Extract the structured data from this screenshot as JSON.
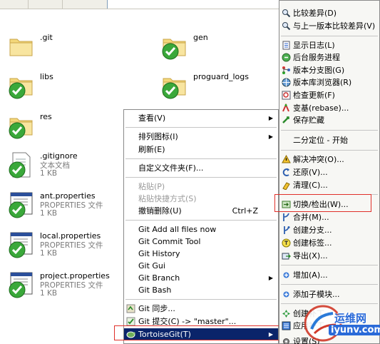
{
  "files": [
    {
      "name": ".git",
      "type": "",
      "size": "",
      "icon": "folder-icon",
      "status": "none"
    },
    {
      "name": "gen",
      "type": "",
      "size": "",
      "icon": "folder-icon",
      "status": "normal-check"
    },
    {
      "name": "libs",
      "type": "",
      "size": "",
      "icon": "folder-icon",
      "status": "normal-check"
    },
    {
      "name": "proguard_logs",
      "type": "",
      "size": "",
      "icon": "folder-icon",
      "status": "normal-check"
    },
    {
      "name": "res",
      "type": "",
      "size": "",
      "icon": "folder-icon",
      "status": "normal-check"
    },
    {
      "name": ".gitignore",
      "type": "文本文档",
      "size": "1 KB",
      "icon": "text-file-icon",
      "status": "normal-check"
    },
    {
      "name": "ant.properties",
      "type": "PROPERTIES 文件",
      "size": "1 KB",
      "icon": "properties-file-icon",
      "status": "normal-check"
    },
    {
      "name": "local.properties",
      "type": "PROPERTIES 文件",
      "size": "1 KB",
      "icon": "properties-file-icon",
      "status": "normal-check"
    },
    {
      "name": "project.properties",
      "type": "PROPERTIES 文件",
      "size": "1 KB",
      "icon": "properties-file-icon",
      "status": "normal-check"
    }
  ],
  "context_menu": {
    "items": [
      {
        "label": "查看(V)",
        "submenu": true
      },
      {
        "label": "排列图标(I)",
        "submenu": true
      },
      {
        "label": "刷新(E)"
      },
      {
        "label": "自定义文件夹(F)..."
      },
      {
        "label": "粘贴(P)",
        "disabled": true
      },
      {
        "label": "粘贴快捷方式(S)",
        "disabled": true
      },
      {
        "label": "撤销删除(U)",
        "shortcut": "Ctrl+Z"
      },
      {
        "label": "Git Add all files now"
      },
      {
        "label": "Git Commit Tool"
      },
      {
        "label": "Git History"
      },
      {
        "label": "Git Gui"
      },
      {
        "label": "Git Branch",
        "submenu": true
      },
      {
        "label": "Git Bash"
      },
      {
        "label": "Git 同步..."
      },
      {
        "label": "Git 提交(C) -> \"master\"..."
      },
      {
        "label": "TortoiseGit(T)",
        "submenu": true,
        "highlighted": true
      }
    ]
  },
  "tortoise_submenu": {
    "items": [
      {
        "label": "比较差异(D)",
        "icon": "magnifier-icon"
      },
      {
        "label": "与上一版本比较差异(V)",
        "icon": "magnifier-icon"
      },
      {
        "label": "显示日志(L)",
        "icon": "log-icon"
      },
      {
        "label": "后台服务进程",
        "icon": "daemon-icon"
      },
      {
        "label": "版本分支图(G)",
        "icon": "revision-graph-icon"
      },
      {
        "label": "版本库浏览器(R)",
        "icon": "repo-browser-icon"
      },
      {
        "label": "检查更新(F)",
        "icon": "check-modifications-icon"
      },
      {
        "label": "变基(rebase)...",
        "icon": "rebase-icon"
      },
      {
        "label": "保存贮藏",
        "icon": "stash-icon"
      },
      {
        "label": "二分定位 - 开始",
        "icon": ""
      },
      {
        "label": "解决冲突(O)...",
        "icon": "conflict-icon"
      },
      {
        "label": "还原(V)...",
        "icon": "revert-icon"
      },
      {
        "label": "清理(C)...",
        "icon": "cleanup-icon"
      },
      {
        "label": "切换/检出(W)...",
        "icon": "switch-icon"
      },
      {
        "label": "合并(M)...",
        "icon": "merge-icon"
      },
      {
        "label": "创建分支...",
        "icon": "branch-icon"
      },
      {
        "label": "创建标签...",
        "icon": "tag-icon"
      },
      {
        "label": "导出(X)...",
        "icon": "export-icon"
      },
      {
        "label": "增加(A)...",
        "icon": "add-icon"
      },
      {
        "label": "添加子模块...",
        "icon": "submodule-icon"
      },
      {
        "label": "创建补丁...",
        "icon": "create-patch-icon"
      },
      {
        "label": "应用补丁...",
        "icon": "apply-patch-icon"
      },
      {
        "label": "设置(S)",
        "icon": "settings-icon"
      }
    ]
  },
  "watermark": {
    "brand": "运维网",
    "url": "iyunv.com"
  },
  "colors": {
    "highlight": "#0a246a",
    "annotation": "#e0302a",
    "check": "#3aa83a",
    "folder": "#f3d77a"
  }
}
